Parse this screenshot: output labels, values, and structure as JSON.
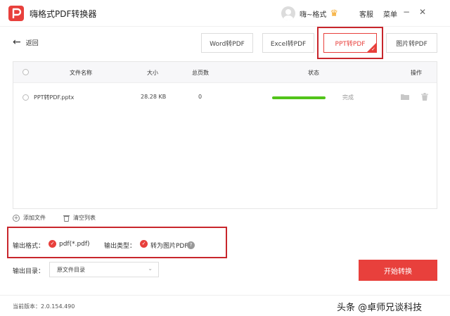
{
  "app": {
    "title": "嗨格式PDF转换器",
    "username": "嗨~格式",
    "service_label": "客服",
    "menu_label": "菜单",
    "minimize_icon": "−",
    "close_icon": "✕"
  },
  "toolbar": {
    "back_label": "返回",
    "tabs": [
      {
        "label": "Word转PDF",
        "active": false
      },
      {
        "label": "Excel转PDF",
        "active": false
      },
      {
        "label": "PPT转PDF",
        "active": true
      },
      {
        "label": "图片转PDF",
        "active": false
      }
    ]
  },
  "table": {
    "columns": [
      "文件名称",
      "大小",
      "总页数",
      "状态",
      "操作"
    ],
    "rows": [
      {
        "name": "PPT转PDF.pptx",
        "size": "28.28 KB",
        "pages": "0",
        "progress": 1.0,
        "status": "完成"
      }
    ]
  },
  "actions": {
    "add_file": "添加文件",
    "clear_list": "清空列表"
  },
  "output": {
    "format_label": "输出格式：",
    "format_value": "pdf(*.pdf)",
    "type_label": "输出类型：",
    "type_value": "转为图片PDF",
    "help_icon": "?",
    "dir_label": "输出目录：",
    "dir_value": "原文件目录"
  },
  "start_button": "开始转换",
  "footer": {
    "version": "当前版本：2.0.154.490",
    "watermark": "头条 @卓师兄谈科技"
  },
  "colors": {
    "accent": "#e8403c",
    "highlight": "#c8262c",
    "progress": "#52c41a"
  }
}
